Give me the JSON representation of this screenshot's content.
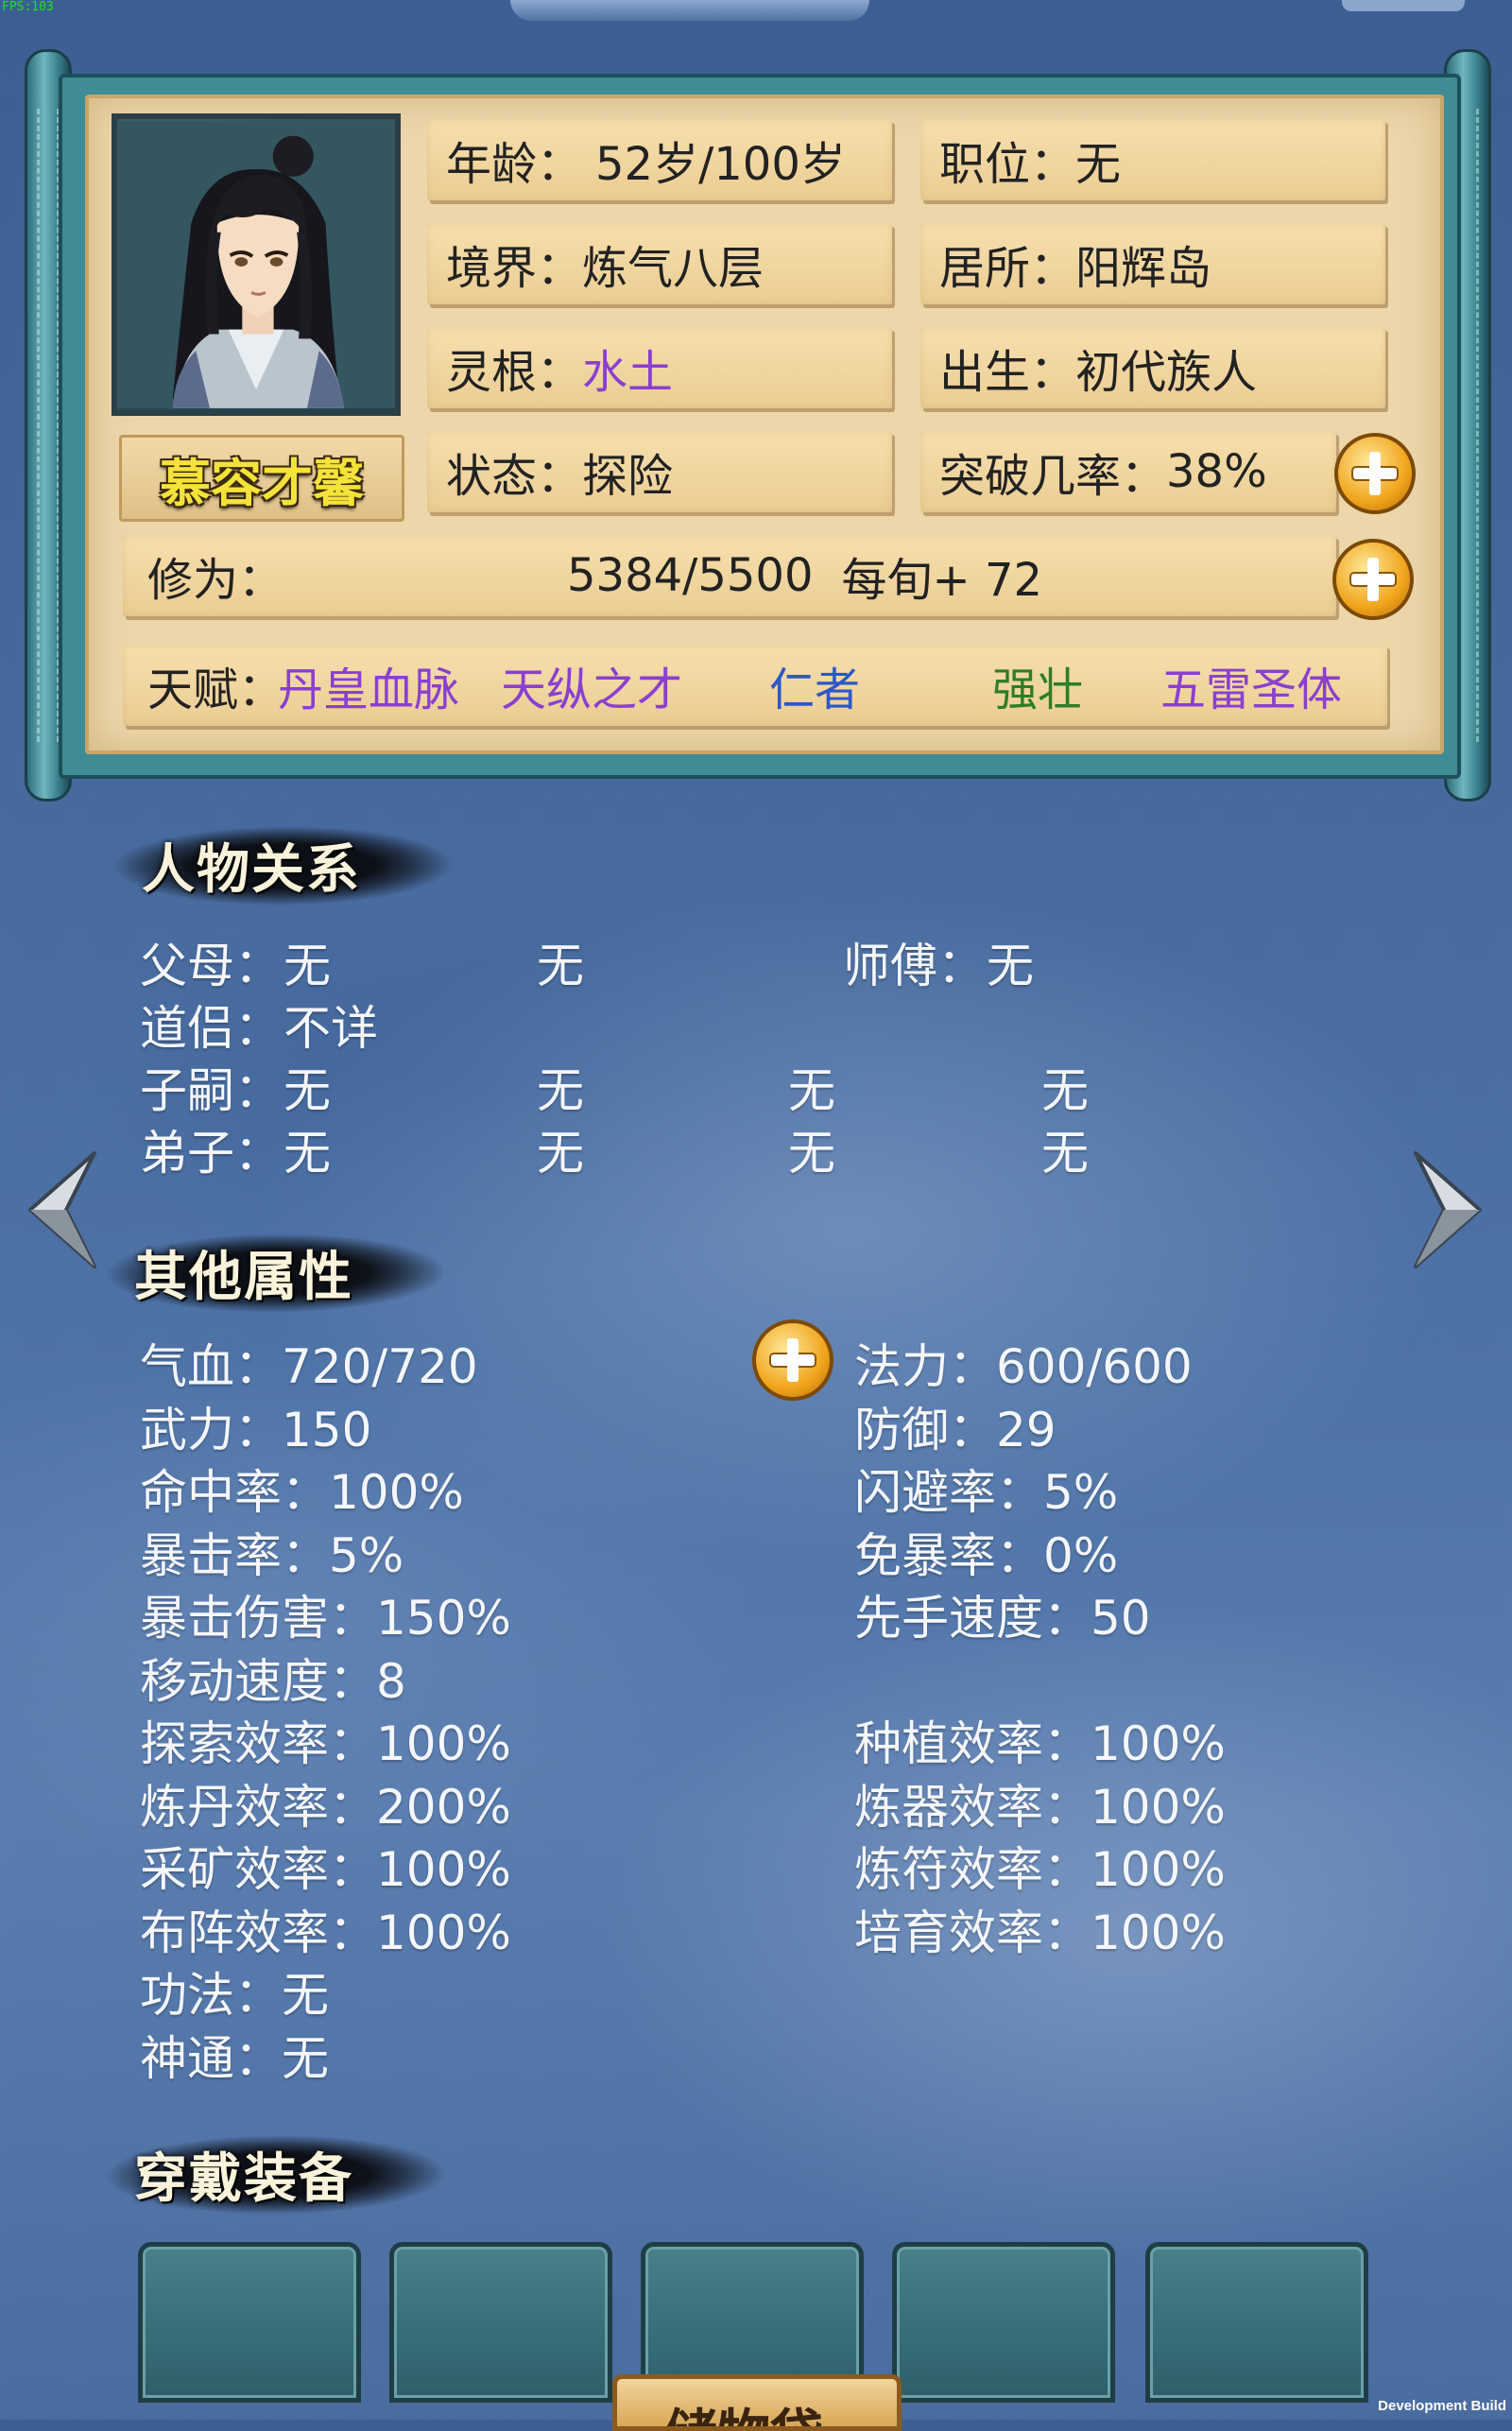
{
  "debug": {
    "fps": "FPS:103",
    "build": "Development Build"
  },
  "character": {
    "name": "慕容才馨",
    "age_label": "年龄：",
    "age_value": "52岁/100岁",
    "position_label": "职位：",
    "position_value": "无",
    "realm_label": "境界：",
    "realm_value": "炼气八层",
    "residence_label": "居所：",
    "residence_value": "阳辉岛",
    "root_label": "灵根：",
    "root_value": "水土",
    "birth_label": "出生：",
    "birth_value": "初代族人",
    "state_label": "状态：",
    "state_value": "探险",
    "breakthrough_label": "突破几率：",
    "breakthrough_value": "38%",
    "cultivation_label": "修为：",
    "cultivation_value": "5384/5500",
    "cultivation_rate": "每旬+ 72",
    "talent_label": "天赋：",
    "talents": [
      "丹皇血脉",
      "天纵之才",
      "仁者",
      "强壮",
      "五雷圣体"
    ]
  },
  "relations": {
    "title": "人物关系",
    "parents_label": "父母：",
    "parents": [
      "无",
      "无"
    ],
    "master_label": "师傅：",
    "master": "无",
    "partner_label": "道侣：",
    "partner": "不详",
    "children_label": "子嗣：",
    "children": [
      "无",
      "无",
      "无",
      "无"
    ],
    "disciples_label": "弟子：",
    "disciples": [
      "无",
      "无",
      "无",
      "无"
    ]
  },
  "attributes": {
    "title": "其他属性",
    "left": [
      "气血：720/720",
      "武力：150",
      "命中率：100%",
      "暴击率：5%",
      "暴击伤害：150%",
      "移动速度：8",
      "探索效率：100%",
      "炼丹效率：200%",
      "采矿效率：100%",
      "布阵效率：100%",
      "功法：无",
      "神通：无"
    ],
    "right": [
      "法力：600/600",
      "防御：29",
      "闪避率：5%",
      "免暴率：0%",
      "先手速度：50",
      "",
      "种植效率：100%",
      "炼器效率：100%",
      "炼符效率：100%",
      "培育效率：100%"
    ]
  },
  "equipment": {
    "title": "穿戴装备",
    "slots": 5,
    "bottom_button": "储物袋"
  },
  "colors": {
    "talent_purple": "#8b3fd0",
    "talent_blue": "#2b58c8",
    "talent_green": "#2e7d27",
    "name_yellow": "#f5e23a"
  }
}
